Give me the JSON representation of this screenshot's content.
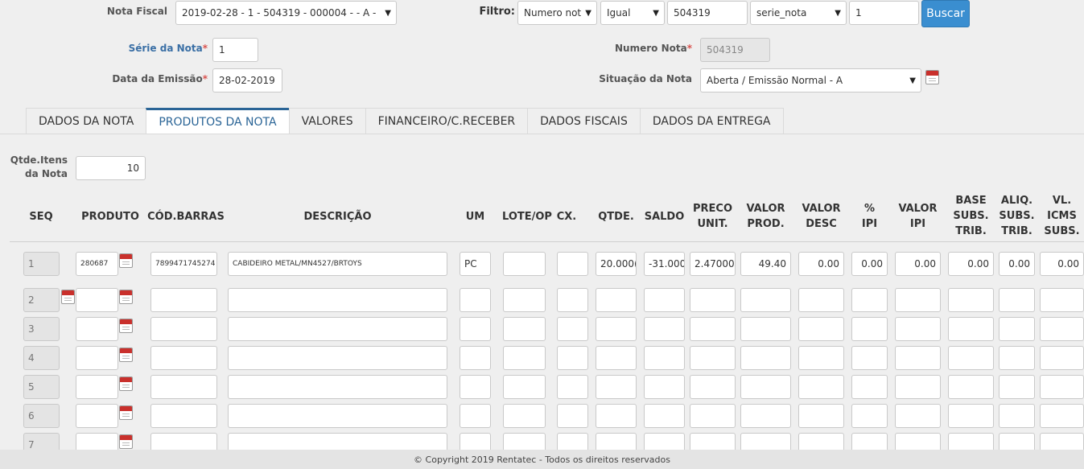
{
  "top": {
    "nota_fiscal_label": "Nota Fiscal",
    "nota_fiscal_value": "2019-02-28 - 1 - 504319 - 000004 - - A -",
    "filtro_label": "Filtro:",
    "filtro_campo": "Numero not",
    "filtro_operador": "Igual",
    "filtro_valor": "504319",
    "filtro_campo2": "serie_nota",
    "filtro_valor2": "1",
    "buscar_label": "Buscar",
    "serie_label": "Série da Nota",
    "serie_value": "1",
    "numero_label": "Numero Nota",
    "numero_value": "504319",
    "data_label": "Data da Emissão",
    "data_value": "28-02-2019",
    "situacao_label": "Situação da Nota",
    "situacao_value": "Aberta / Emissão Normal - A",
    "required_mark": "*"
  },
  "tabs": [
    {
      "label": "DADOS DA NOTA",
      "active": false
    },
    {
      "label": "PRODUTOS DA NOTA",
      "active": true
    },
    {
      "label": "VALORES",
      "active": false
    },
    {
      "label": "FINANCEIRO/C.RECEBER",
      "active": false
    },
    {
      "label": "DADOS FISCAIS",
      "active": false
    },
    {
      "label": "DADOS DA ENTREGA",
      "active": false
    }
  ],
  "qtde": {
    "label_line1": "Qtde.Itens",
    "label_line2": "da Nota",
    "value": "10"
  },
  "columns": {
    "seq": "SEQ",
    "produto": "PRODUTO",
    "cod_barras": "CÓD.BARRAS",
    "descricao": "DESCRIÇÃO",
    "um": "UM",
    "lote": "LOTE/OP",
    "cx": "CX.",
    "qtde": "QTDE.",
    "saldo": "SALDO",
    "preco_1": "PRECO",
    "preco_2": "UNIT.",
    "valor_prod_1": "VALOR",
    "valor_prod_2": "PROD.",
    "valor_desc_1": "VALOR",
    "valor_desc_2": "DESC",
    "ipi_pct_1": "%",
    "ipi_pct_2": "IPI",
    "valor_ipi_1": "VALOR",
    "valor_ipi_2": "IPI",
    "base_st_1": "BASE",
    "base_st_2": "SUBS.",
    "base_st_3": "TRIB.",
    "aliq_st_1": "ALIQ.",
    "aliq_st_2": "SUBS.",
    "aliq_st_3": "TRIB.",
    "vl_icms_1": "VL.",
    "vl_icms_2": "ICMS",
    "vl_icms_3": "SUBS."
  },
  "row1": {
    "seq": "1",
    "produto": "280687",
    "cod_barras": "7899471745274",
    "descricao": "CABIDEIRO METAL/MN4527/BRTOYS",
    "um": "PC",
    "lote": "",
    "cx": "",
    "qtde": "20.000(",
    "saldo": "-31.000(",
    "preco": "2.47000",
    "valor_prod": "49.40",
    "valor_desc": "0.00",
    "ipi_pct": "0.00",
    "valor_ipi": "0.00",
    "base_st": "0.00",
    "aliq_st": "0.00",
    "vl_icms": "0.00"
  },
  "empty_rows": [
    "2",
    "3",
    "4",
    "5",
    "6",
    "7"
  ],
  "footer": "© Copyright 2019 Rentatec - Todos os direitos reservados"
}
